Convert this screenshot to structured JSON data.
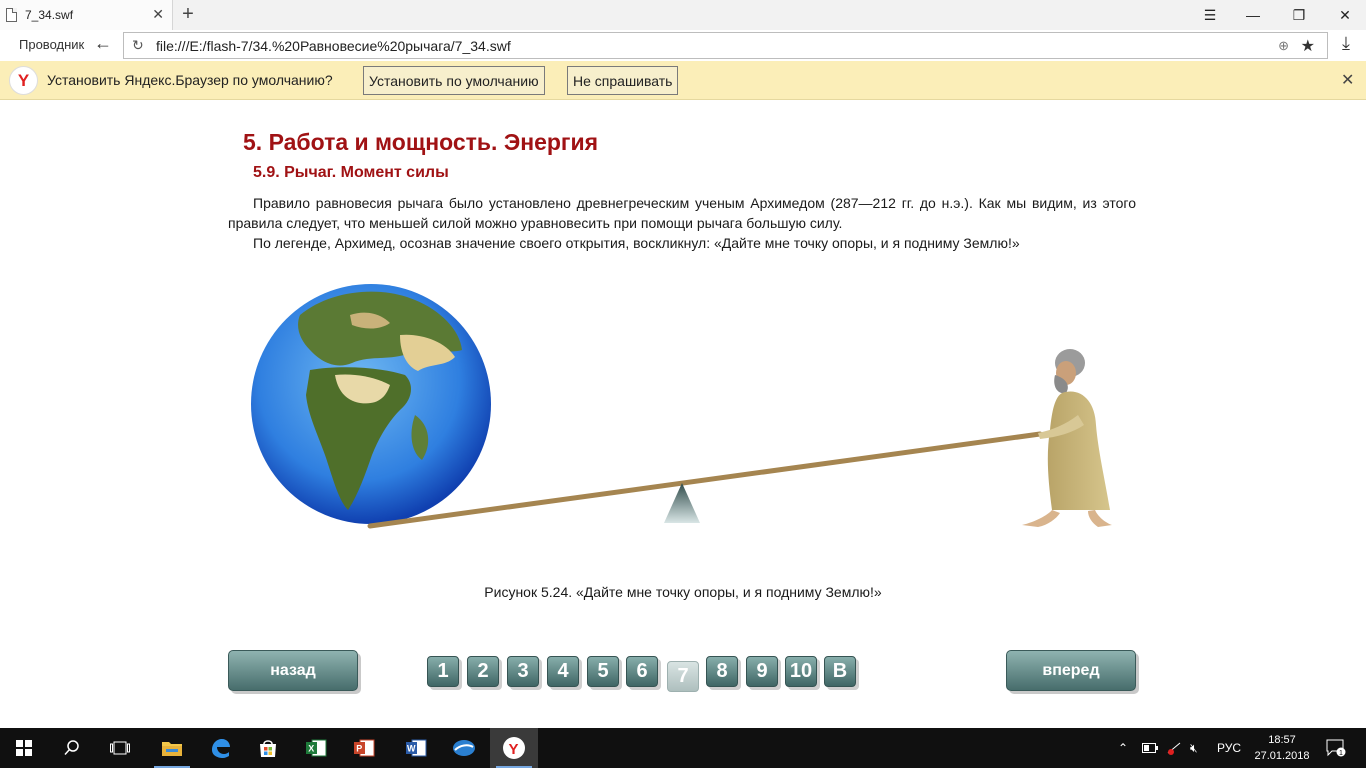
{
  "browser": {
    "tab_title": "7_34.swf",
    "new_tab": "+",
    "back_label": "Проводник",
    "url": "file:///E:/flash-7/34.%20Равновесие%20рычага/7_34.swf"
  },
  "notification": {
    "text": "Установить Яндекс.Браузер по умолчанию?",
    "set_default": "Установить по умолчанию",
    "dont_ask": "Не спрашивать",
    "logo_letter": "Y"
  },
  "content": {
    "heading": "5. Работа и мощность. Энергия",
    "subheading": "5.9. Рычаг. Момент силы",
    "paragraph1": "Правило равновесия рычага было установлено древнегреческим ученым Архимедом (287—212 гг. до н.э.). Как мы видим, из этого правила следует, что меньшей силой можно уравновесить при помощи рычага большую силу.",
    "paragraph2": "По легенде, Архимед, осознав значение своего открытия, воскликнул: «Дайте мне точку опоры, и я подниму Землю!»",
    "caption": "Рисунок 5.24. «Дайте мне точку опоры, и я подниму Землю!»"
  },
  "navigation": {
    "back": "назад",
    "forward": "вперед",
    "pages": [
      "1",
      "2",
      "3",
      "4",
      "5",
      "6",
      "7",
      "8",
      "9",
      "10",
      "B"
    ],
    "current_page": "7"
  },
  "taskbar": {
    "language": "РУС",
    "time": "18:57",
    "date": "27.01.2018",
    "notifications_count": "1"
  }
}
